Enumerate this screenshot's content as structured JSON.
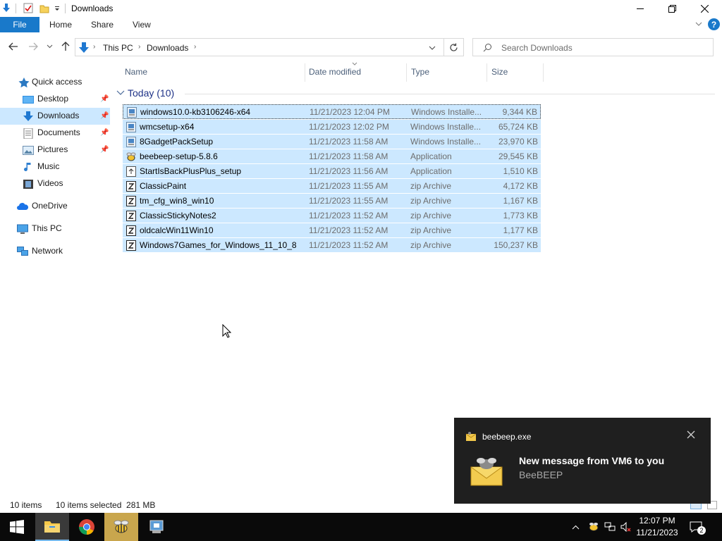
{
  "window": {
    "title": "Downloads",
    "help_glyph": "?"
  },
  "ribbon": {
    "file": "File",
    "tabs": [
      "Home",
      "Share",
      "View"
    ]
  },
  "address": {
    "crumbs": [
      "This PC",
      "Downloads"
    ],
    "search_placeholder": "Search Downloads"
  },
  "nav": {
    "items": [
      {
        "label": "Quick access",
        "icon": "star-icon"
      },
      {
        "label": "Desktop",
        "icon": "desktop-folder-icon",
        "pinned": true
      },
      {
        "label": "Downloads",
        "icon": "download-arrow-icon",
        "pinned": true,
        "selected": true
      },
      {
        "label": "Documents",
        "icon": "documents-icon",
        "pinned": true
      },
      {
        "label": "Pictures",
        "icon": "pictures-icon",
        "pinned": true
      },
      {
        "label": "Music",
        "icon": "music-note-icon"
      },
      {
        "label": "Videos",
        "icon": "videos-icon"
      },
      {
        "label": "OneDrive",
        "icon": "cloud-icon"
      },
      {
        "label": "This PC",
        "icon": "computer-icon"
      },
      {
        "label": "Network",
        "icon": "network-icon"
      }
    ]
  },
  "columns": {
    "name": "Name",
    "date": "Date modified",
    "type": "Type",
    "size": "Size"
  },
  "group": {
    "label": "Today (10)"
  },
  "files": [
    {
      "name": "windows10.0-kb3106246-x64",
      "date": "11/21/2023 12:04 PM",
      "type": "Windows Installe...",
      "size": "9,344 KB",
      "icon": "installer-icon"
    },
    {
      "name": "wmcsetup-x64",
      "date": "11/21/2023 12:02 PM",
      "type": "Windows Installe...",
      "size": "65,724 KB",
      "icon": "installer-icon"
    },
    {
      "name": "8GadgetPackSetup",
      "date": "11/21/2023 11:58 AM",
      "type": "Windows Installe...",
      "size": "23,970 KB",
      "icon": "installer-icon"
    },
    {
      "name": "beebeep-setup-5.8.6",
      "date": "11/21/2023 11:58 AM",
      "type": "Application",
      "size": "29,545 KB",
      "icon": "beebeep-app-icon"
    },
    {
      "name": "StartIsBackPlusPlus_setup",
      "date": "11/21/2023 11:56 AM",
      "type": "Application",
      "size": "1,510 KB",
      "icon": "setup-app-icon"
    },
    {
      "name": "ClassicPaint",
      "date": "11/21/2023 11:55 AM",
      "type": "zip Archive",
      "size": "4,172 KB",
      "icon": "zip-icon"
    },
    {
      "name": "tm_cfg_win8_win10",
      "date": "11/21/2023 11:55 AM",
      "type": "zip Archive",
      "size": "1,167 KB",
      "icon": "zip-icon"
    },
    {
      "name": "ClassicStickyNotes2",
      "date": "11/21/2023 11:52 AM",
      "type": "zip Archive",
      "size": "1,773 KB",
      "icon": "zip-icon"
    },
    {
      "name": "oldcalcWin11Win10",
      "date": "11/21/2023 11:52 AM",
      "type": "zip Archive",
      "size": "1,177 KB",
      "icon": "zip-icon"
    },
    {
      "name": "Windows7Games_for_Windows_11_10_8",
      "date": "11/21/2023 11:52 AM",
      "type": "zip Archive",
      "size": "150,237 KB",
      "icon": "zip-icon"
    }
  ],
  "status": {
    "count": "10 items",
    "selected": "10 items selected  281 MB"
  },
  "toast": {
    "app": "beebeep.exe",
    "title": "New message from VM6 to you",
    "body": "BeeBEEP"
  },
  "taskbar": {
    "time": "12:07 PM",
    "date": "11/21/2023",
    "notifications": "2"
  },
  "colors": {
    "accent": "#1979ca",
    "selection": "#cce8ff",
    "toast_bg": "#1f1f1f",
    "taskbar_bg": "#0a0a0a"
  }
}
